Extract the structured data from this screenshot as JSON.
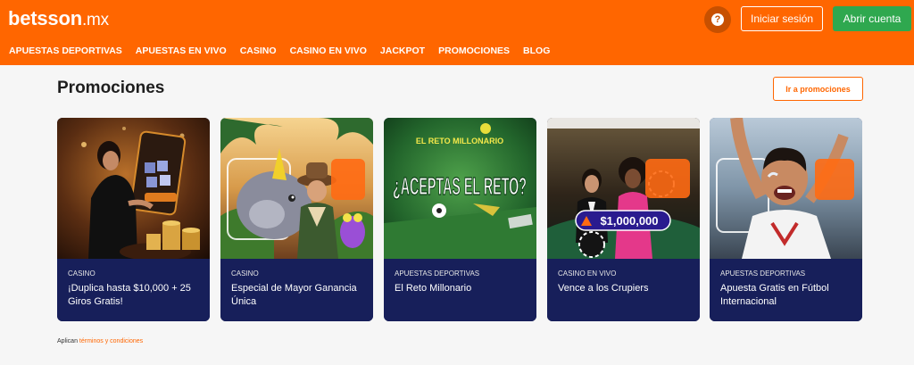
{
  "header": {
    "logo_main": "betsson",
    "logo_tld": ".mx",
    "help_label": "?",
    "login_label": "Iniciar sesión",
    "signup_label": "Abrir cuenta",
    "nav": [
      "APUESTAS DEPORTIVAS",
      "APUESTAS EN VIVO",
      "CASINO",
      "CASINO EN VIVO",
      "JACKPOT",
      "PROMOCIONES",
      "BLOG"
    ]
  },
  "promos": {
    "title": "Promociones",
    "goto_label": "Ir a promociones",
    "cards": [
      {
        "category": "CASINO",
        "title": "¡Duplica hasta $10,000 + 25 Giros Gratis!"
      },
      {
        "category": "CASINO",
        "title": "Especial de Mayor Ganancia Única"
      },
      {
        "category": "APUESTAS DEPORTIVAS",
        "title": "El Reto Millonario",
        "art_kicker": "EL RETO MILLONARIO",
        "art_headline": "¿ACEPTAS EL RETO?"
      },
      {
        "category": "CASINO EN VIVO",
        "title": "Vence a los Crupiers",
        "art_amount": "$1,000,000"
      },
      {
        "category": "APUESTAS DEPORTIVAS",
        "title": "Apuesta Gratis en Fútbol Internacional"
      }
    ]
  },
  "footnote": {
    "prefix": "Aplican",
    "link": "términos y condiciones"
  },
  "colors": {
    "brand": "#ff6600",
    "signup": "#2fa84f",
    "card_caption": "#171f5a"
  }
}
